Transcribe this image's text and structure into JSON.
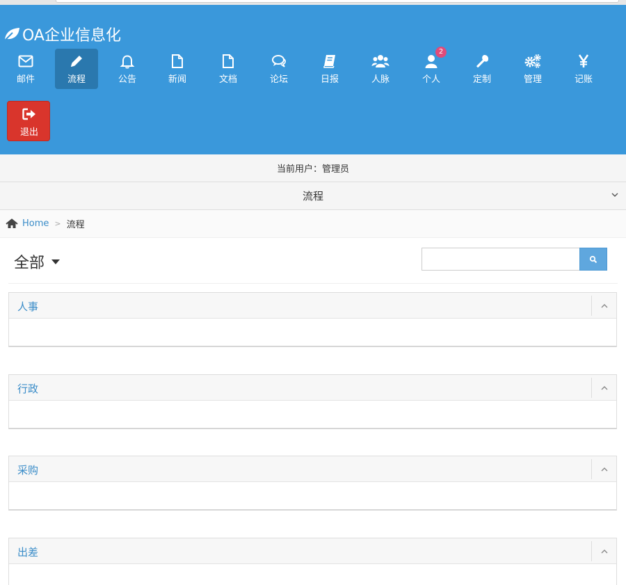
{
  "app": {
    "brand": "OA企业信息化",
    "colors": {
      "header": "#3a98db",
      "active": "#2a78ae",
      "logout": "#d9352c",
      "link": "#3a8cc8"
    }
  },
  "nav": {
    "items": [
      {
        "label": "邮件",
        "icon": "envelope-icon"
      },
      {
        "label": "流程",
        "icon": "pencil-icon",
        "active": true
      },
      {
        "label": "公告",
        "icon": "bell-icon"
      },
      {
        "label": "新闻",
        "icon": "file-icon"
      },
      {
        "label": "文档",
        "icon": "file-icon"
      },
      {
        "label": "论坛",
        "icon": "comments-icon"
      },
      {
        "label": "日报",
        "icon": "book-icon"
      },
      {
        "label": "人脉",
        "icon": "users-icon"
      },
      {
        "label": "个人",
        "icon": "user-icon",
        "badge": "2"
      },
      {
        "label": "定制",
        "icon": "wrench-icon"
      },
      {
        "label": "管理",
        "icon": "gears-icon"
      },
      {
        "label": "记账",
        "icon": "yen-icon"
      }
    ],
    "logout": {
      "label": "退出",
      "icon": "sign-out-icon"
    }
  },
  "userbar": {
    "text": "当前用户：管理员"
  },
  "module": {
    "title": "流程"
  },
  "breadcrumb": {
    "home": "Home",
    "current": "流程"
  },
  "filter": {
    "selected": "全部"
  },
  "search": {
    "value": "",
    "placeholder": ""
  },
  "panels": [
    {
      "title": "人事"
    },
    {
      "title": "行政"
    },
    {
      "title": "采购"
    },
    {
      "title": "出差"
    }
  ]
}
